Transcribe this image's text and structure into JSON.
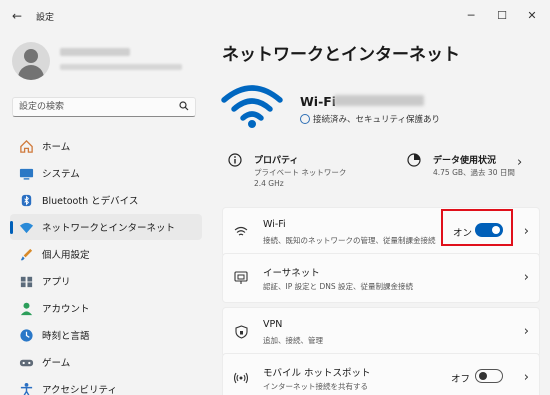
{
  "titlebar": {
    "app_title": "設定",
    "back": "←",
    "minimize": "─",
    "maximize": "☐",
    "close": "✕"
  },
  "sidebar": {
    "search_placeholder": "設定の検索",
    "items": [
      {
        "label": "ホーム",
        "icon": "home-icon",
        "color": "#d07a3c"
      },
      {
        "label": "システム",
        "icon": "system-icon",
        "color": "#2b78c5"
      },
      {
        "label": "Bluetooth とデバイス",
        "icon": "bluetooth-icon",
        "color": "#2a6fc2"
      },
      {
        "label": "ネットワークとインターネット",
        "icon": "network-icon",
        "color": "#2a8ad8",
        "active": true
      },
      {
        "label": "個人用設定",
        "icon": "personalization-icon",
        "color": "#d88a2a"
      },
      {
        "label": "アプリ",
        "icon": "apps-icon",
        "color": "#5b6b7b"
      },
      {
        "label": "アカウント",
        "icon": "account-icon",
        "color": "#2c9e5a"
      },
      {
        "label": "時刻と言語",
        "icon": "time-language-icon",
        "color": "#2a78c8"
      },
      {
        "label": "ゲーム",
        "icon": "gaming-icon",
        "color": "#606b78"
      },
      {
        "label": "アクセシビリティ",
        "icon": "accessibility-icon",
        "color": "#2a6fc2"
      }
    ]
  },
  "main": {
    "title": "ネットワークとインターネット",
    "network": {
      "name": "Wi-Fi",
      "status": "接続済み、セキュリティ保護あり"
    },
    "properties": {
      "title": "プロパティ",
      "sub1": "プライベート ネットワーク",
      "sub2": "2.4 GHz"
    },
    "data_usage": {
      "title": "データ使用状況",
      "sub": "4.75 GB、過去 30 日間"
    },
    "cards": [
      {
        "title": "Wi-Fi",
        "sub": "接続、既知のネットワークの管理、従量制課金接続",
        "icon": "wifi-icon",
        "toggle": "オン",
        "toggle_on": true
      },
      {
        "title": "イーサネット",
        "sub": "認証、IP 設定と DNS 設定、従量制課金接続",
        "icon": "ethernet-icon"
      },
      {
        "title": "VPN",
        "sub": "追加、接続、管理",
        "icon": "vpn-shield-icon"
      },
      {
        "title": "モバイル ホットスポット",
        "sub": "インターネット接続を共有する",
        "icon": "hotspot-icon",
        "toggle": "オフ",
        "toggle_on": false
      }
    ]
  },
  "colors": {
    "accent": "#005fb8",
    "highlight": "#e0101b"
  }
}
